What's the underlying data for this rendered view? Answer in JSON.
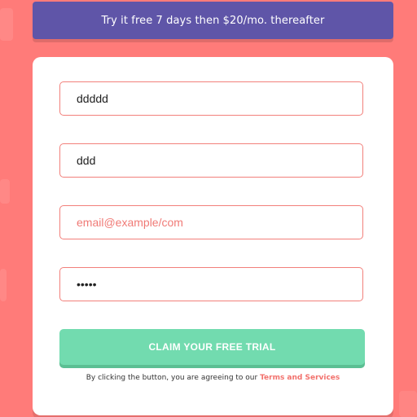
{
  "banner": {
    "text": "Try it free 7 days then $20/mo. thereafter"
  },
  "form": {
    "first_name_value": "ddddd",
    "last_name_value": "ddd",
    "email_placeholder": "email@example/com",
    "password_value": "•••••",
    "submit_label": "CLAIM YOUR FREE TRIAL",
    "terms_prefix": "By clicking the button, you are agreeing to our ",
    "terms_link": "Terms and Services"
  },
  "colors": {
    "background": "#ff7b79",
    "banner": "#5f55a8",
    "submit": "#72dbaf",
    "field_border": "#f2807b",
    "link": "#f2716c"
  }
}
